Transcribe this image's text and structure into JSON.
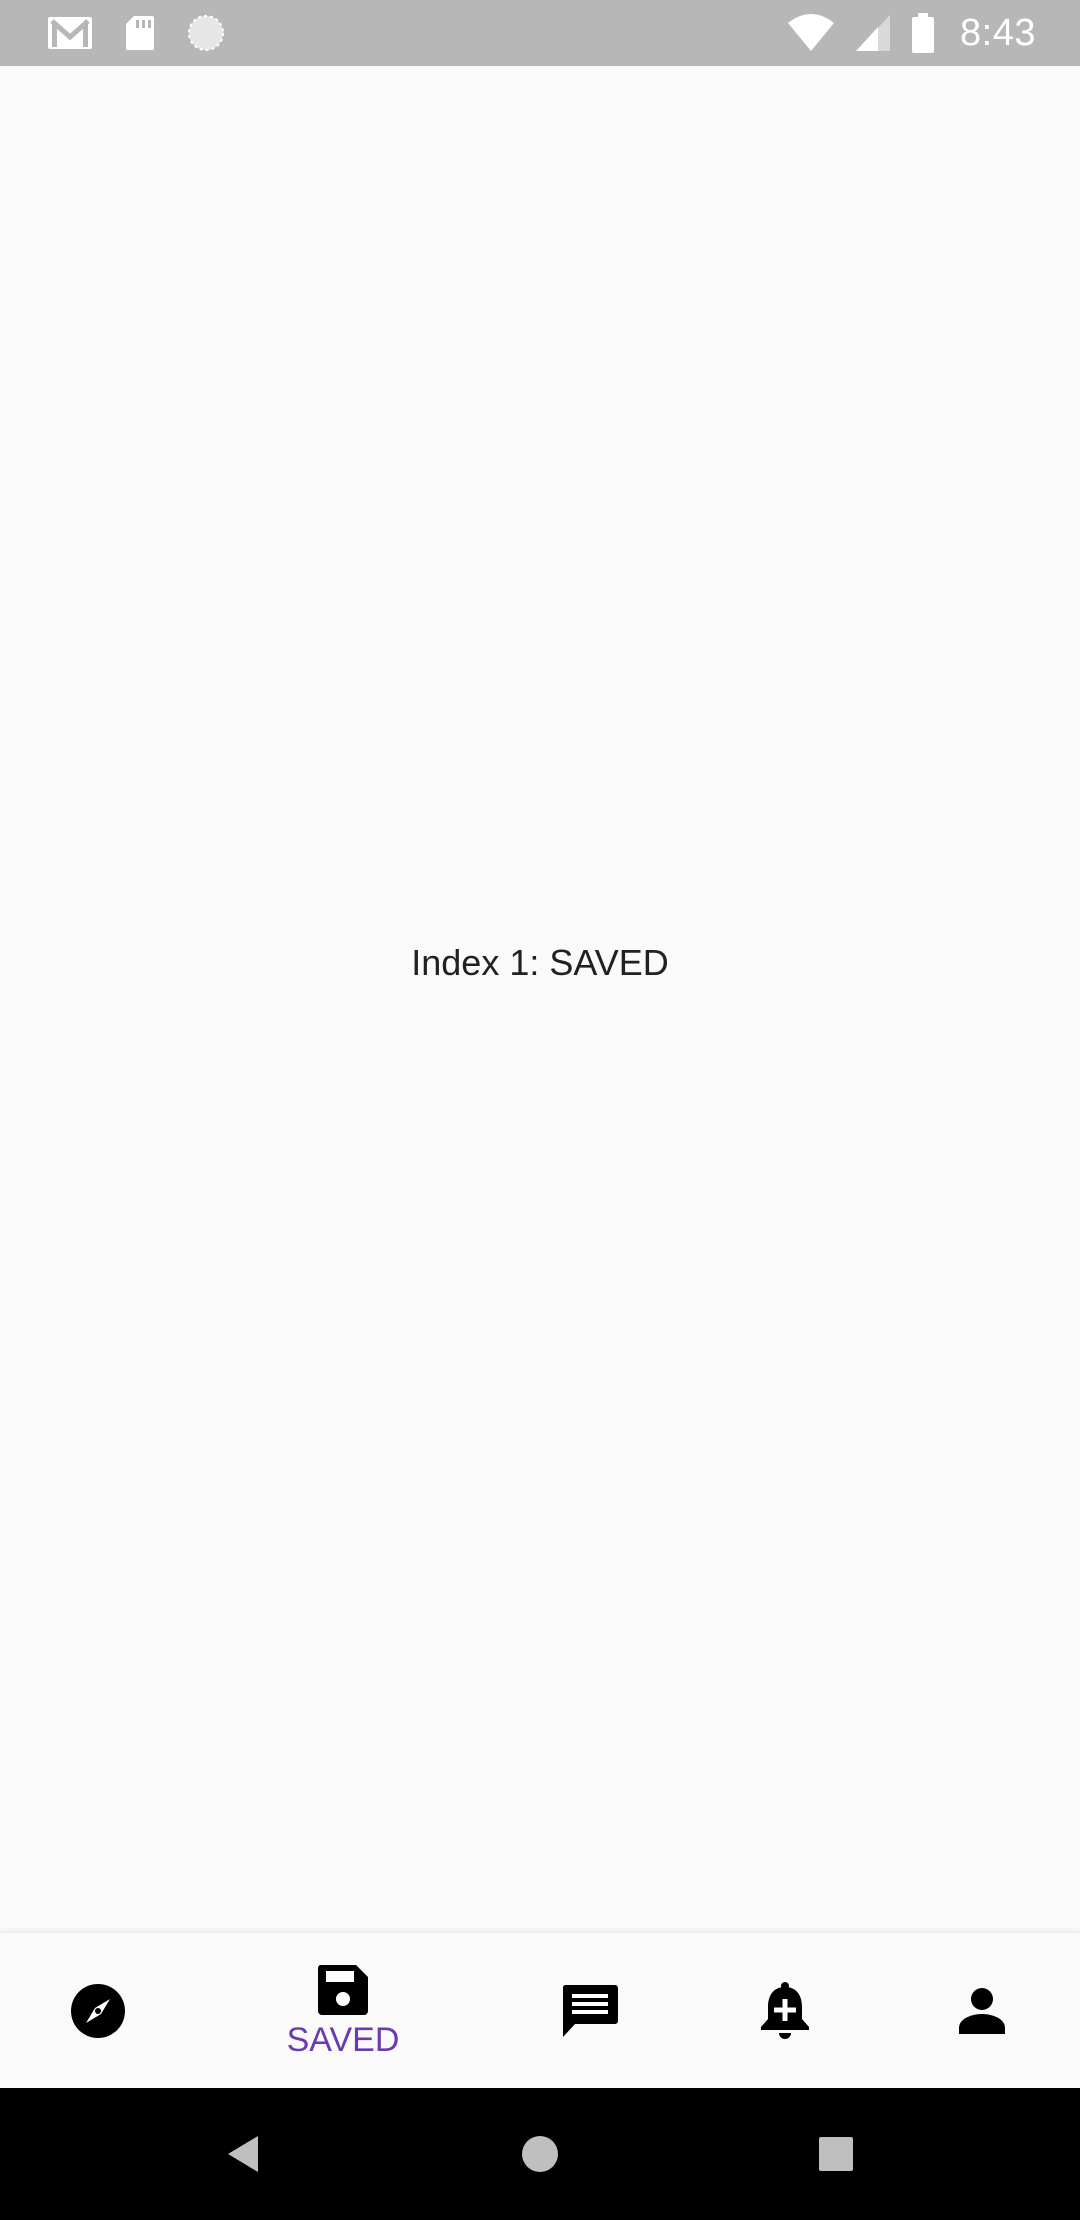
{
  "status_bar": {
    "time": "8:43",
    "left_icons": [
      "gmail-icon",
      "sd-card-icon",
      "sync-icon"
    ],
    "right_icons": [
      "wifi-icon",
      "signal-icon",
      "battery-icon"
    ]
  },
  "content": {
    "text": "Index 1: SAVED"
  },
  "bottom_nav": {
    "selected_index": 1,
    "accent_color": "#6a3ab2",
    "items": [
      {
        "icon": "compass-icon",
        "label": ""
      },
      {
        "icon": "save-icon",
        "label": "SAVED"
      },
      {
        "icon": "message-icon",
        "label": ""
      },
      {
        "icon": "bell-plus-icon",
        "label": ""
      },
      {
        "icon": "person-icon",
        "label": ""
      }
    ]
  },
  "system_nav": {
    "buttons": [
      "back-icon",
      "home-icon",
      "recents-icon"
    ]
  }
}
